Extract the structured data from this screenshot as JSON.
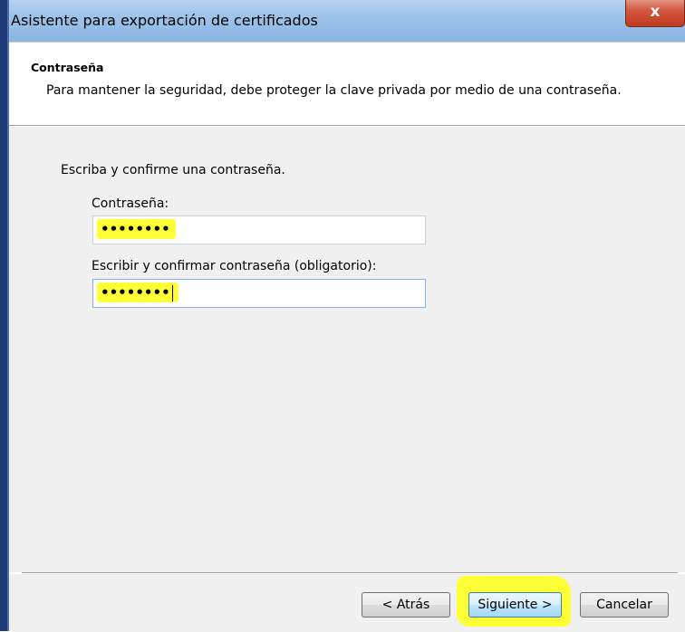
{
  "window": {
    "title": "Asistente para exportación de certificados",
    "close_glyph": "x"
  },
  "header": {
    "title": "Contraseña",
    "description": "Para mantener la seguridad, debe proteger la clave privada por medio de una contraseña."
  },
  "form": {
    "instruction": "Escriba y confirme una contraseña.",
    "password_label": "Contraseña:",
    "password_value": "••••••••",
    "confirm_label": "Escribir y confirmar contraseña (obligatorio):",
    "confirm_value": "••••••••"
  },
  "buttons": {
    "back": "< Atrás",
    "next": "Siguiente >",
    "cancel": "Cancelar"
  },
  "colors": {
    "highlight": "#ffff38",
    "titlebar": "#9dc3e9",
    "close": "#c03a1f"
  }
}
